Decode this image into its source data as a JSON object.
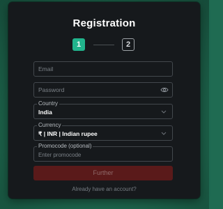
{
  "modal": {
    "title": "Registration"
  },
  "steps": {
    "step1": "1",
    "step2": "2"
  },
  "form": {
    "email_placeholder": "Email",
    "password_placeholder": "Password",
    "country_label": "Country",
    "country_value": "India",
    "currency_label": "Currency",
    "currency_value": "₹ | INR | Indian rupee",
    "promocode_label": "Promocode (optional)",
    "promocode_placeholder": "Enter promocode"
  },
  "actions": {
    "further_label": "Further",
    "account_link": "Already have an account?"
  },
  "colors": {
    "accent": "#21b48c",
    "button_disabled": "#5a1a1a",
    "background": "#16191c"
  },
  "icons": {
    "password_toggle": "eye-icon",
    "dropdown": "chevron-down-icon"
  }
}
